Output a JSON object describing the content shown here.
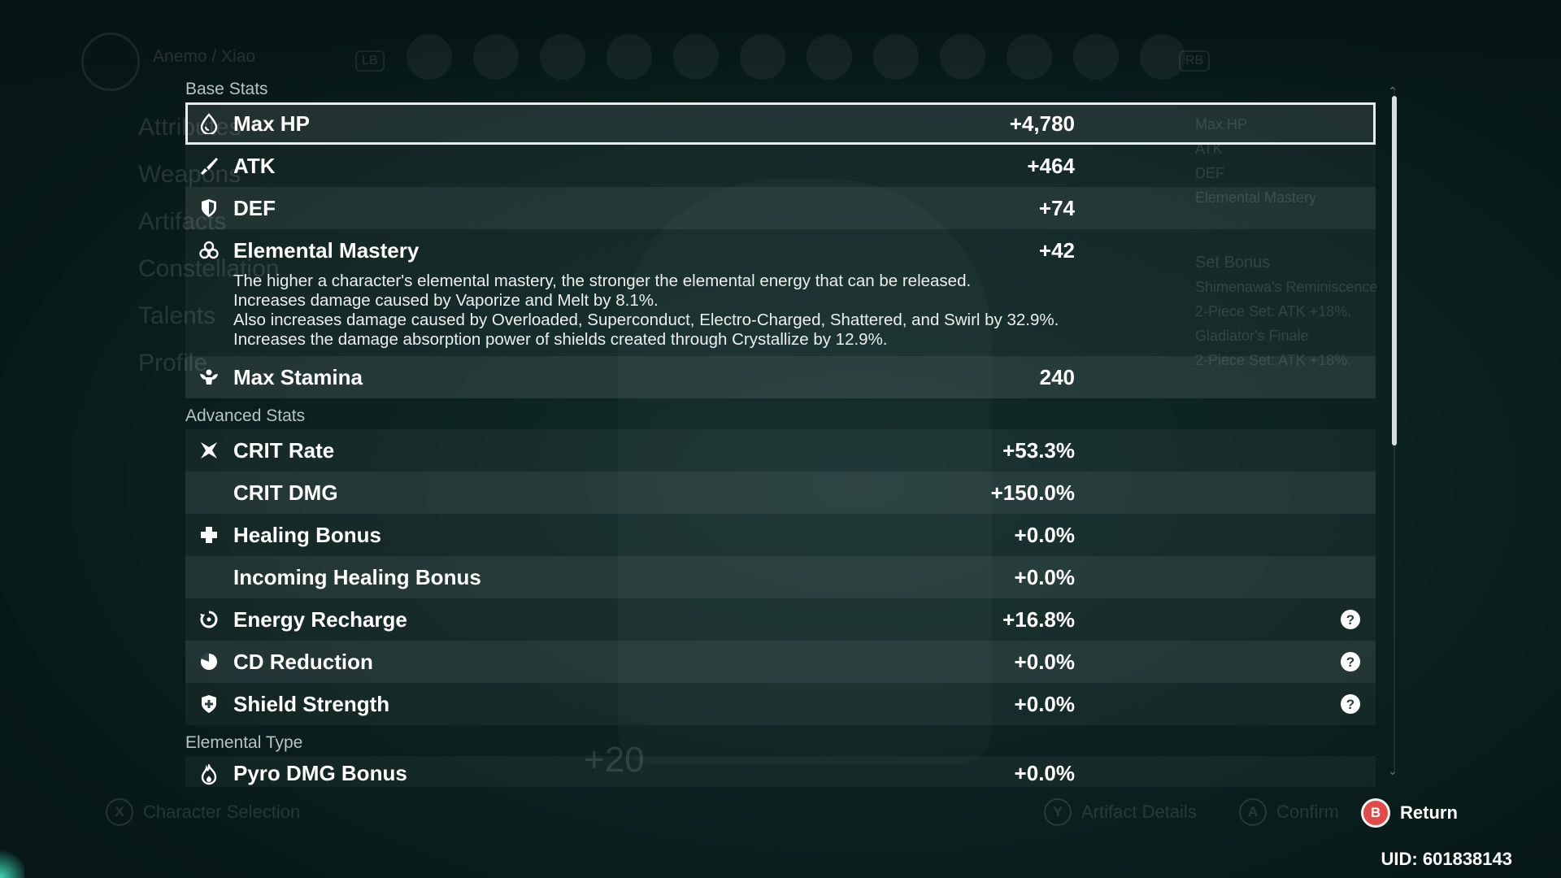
{
  "background": {
    "character_path": "Anemo / Xiao",
    "shoulder_left": "LB",
    "shoulder_right": "RB",
    "menu": [
      "Attributes",
      "Weapons",
      "Artifacts",
      "Constellation",
      "Talents",
      "Profile"
    ],
    "right_panel": {
      "stats": [
        "Max HP",
        "ATK",
        "DEF",
        "Elemental Mastery"
      ],
      "set_bonus_title": "Set Bonus",
      "sets": [
        {
          "name": "Shimenawa's Reminiscence",
          "effect": "2-Piece Set: ATK +18%."
        },
        {
          "name": "Gladiator's Finale",
          "effect": "2-Piece Set: ATK +18%."
        }
      ]
    },
    "level_badge": "+20"
  },
  "sections": {
    "base": "Base Stats",
    "advanced": "Advanced Stats",
    "elemental": "Elemental Type"
  },
  "base_stats": [
    {
      "label": "Max HP",
      "value": "+4,780",
      "icon": "hp-drop-icon"
    },
    {
      "label": "ATK",
      "value": "+464",
      "icon": "sword-icon"
    },
    {
      "label": "DEF",
      "value": "+74",
      "icon": "shield-icon"
    },
    {
      "label": "Elemental Mastery",
      "value": "+42",
      "icon": "elemental-mastery-icon"
    },
    {
      "label": "Max Stamina",
      "value": "240",
      "icon": "stamina-icon"
    }
  ],
  "em_description": [
    "The higher a character's elemental mastery, the stronger the elemental energy that can be released.",
    "Increases damage caused by Vaporize and Melt by 8.1%.",
    "Also increases damage caused by Overloaded, Superconduct, Electro-Charged, Shattered, and Swirl by 32.9%.",
    "Increases the damage absorption power of shields created through Crystallize by 12.9%."
  ],
  "advanced_stats": [
    {
      "label": "CRIT Rate",
      "value": "+53.3%",
      "icon": "crit-icon"
    },
    {
      "label": "CRIT DMG",
      "value": "+150.0%"
    },
    {
      "label": "Healing Bonus",
      "value": "+0.0%",
      "icon": "healing-cross-icon"
    },
    {
      "label": "Incoming Healing Bonus",
      "value": "+0.0%"
    },
    {
      "label": "Energy Recharge",
      "value": "+16.8%",
      "icon": "energy-recharge-icon"
    },
    {
      "label": "CD Reduction",
      "value": "+0.0%",
      "icon": "cd-reduction-icon"
    },
    {
      "label": "Shield Strength",
      "value": "+0.0%",
      "icon": "shield-strength-icon"
    }
  ],
  "elemental_stats": [
    {
      "label": "Pyro DMG Bonus",
      "value": "+0.0%",
      "icon": "pyro-icon"
    }
  ],
  "bottom_hints": {
    "x": {
      "key": "X",
      "label": "Character Selection"
    },
    "y": {
      "key": "Y",
      "label": "Artifact Details"
    },
    "a": {
      "key": "A",
      "label": "Confirm"
    },
    "b": {
      "key": "B",
      "label": "Return"
    }
  },
  "uid": "UID: 601838143",
  "colors": {
    "return_button": "#e04b4b",
    "selected_outline": "#e8eceb"
  }
}
